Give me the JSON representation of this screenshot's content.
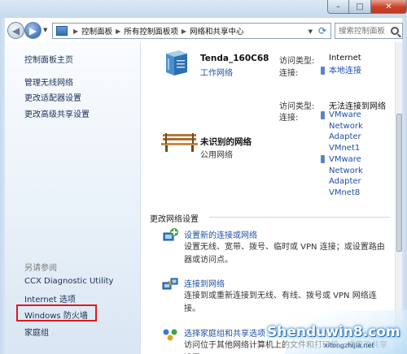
{
  "window": {
    "minimize_glyph": "–",
    "maximize_glyph": "□",
    "close_glyph": "✕"
  },
  "navigation": {
    "back_glyph": "◀",
    "forward_glyph": "▶"
  },
  "address_bar": {
    "crumbs": [
      "控制面板",
      "所有控制面板项",
      "网络和共享中心"
    ],
    "separator": "▶"
  },
  "search": {
    "placeholder": "搜索控制面板"
  },
  "sidebar": {
    "home": "控制面板主页",
    "links": [
      "管理无线网络",
      "更改适配器设置",
      "更改高级共享设置"
    ],
    "see_also_heading": "另请参阅",
    "see_also": [
      "CCX Diagnostic Utility",
      "Internet 选项",
      "Windows 防火墙",
      "家庭组"
    ]
  },
  "networks": [
    {
      "name": "Tenda_160C68",
      "type": "工作网络",
      "access_label": "访问类型:",
      "access_value": "Internet",
      "conn_label": "连接:",
      "conn_value": "本地连接"
    },
    {
      "name": "未识别的网络",
      "type": "公用网络",
      "access_label": "访问类型:",
      "access_value": "无法连接到网络",
      "conn_label": "连接:",
      "conn_value_1": "VMware Network Adapter VMnet1",
      "conn_value_2": "VMware Network Adapter VMnet8"
    }
  ],
  "change_settings": {
    "title": "更改网络设置",
    "tasks": [
      {
        "link": "设置新的连接或网络",
        "desc": "设置无线、宽带、拨号、临时或 VPN 连接；或设置路由器或访问点。"
      },
      {
        "link": "连接到网络",
        "desc": "连接到或重新连接到无线、有线、拨号或 VPN 网络连接。"
      },
      {
        "link": "选择家庭组和共享选项",
        "desc": "访问位于其他网络计算机上的文件和打印机，或更改共享设置。"
      }
    ]
  },
  "watermark": {
    "title": "Shenduwin8.com",
    "subtitle": "xitongzhijia.net"
  },
  "colors": {
    "link": "#1f4fa8",
    "highlight_box": "#e0191d"
  }
}
